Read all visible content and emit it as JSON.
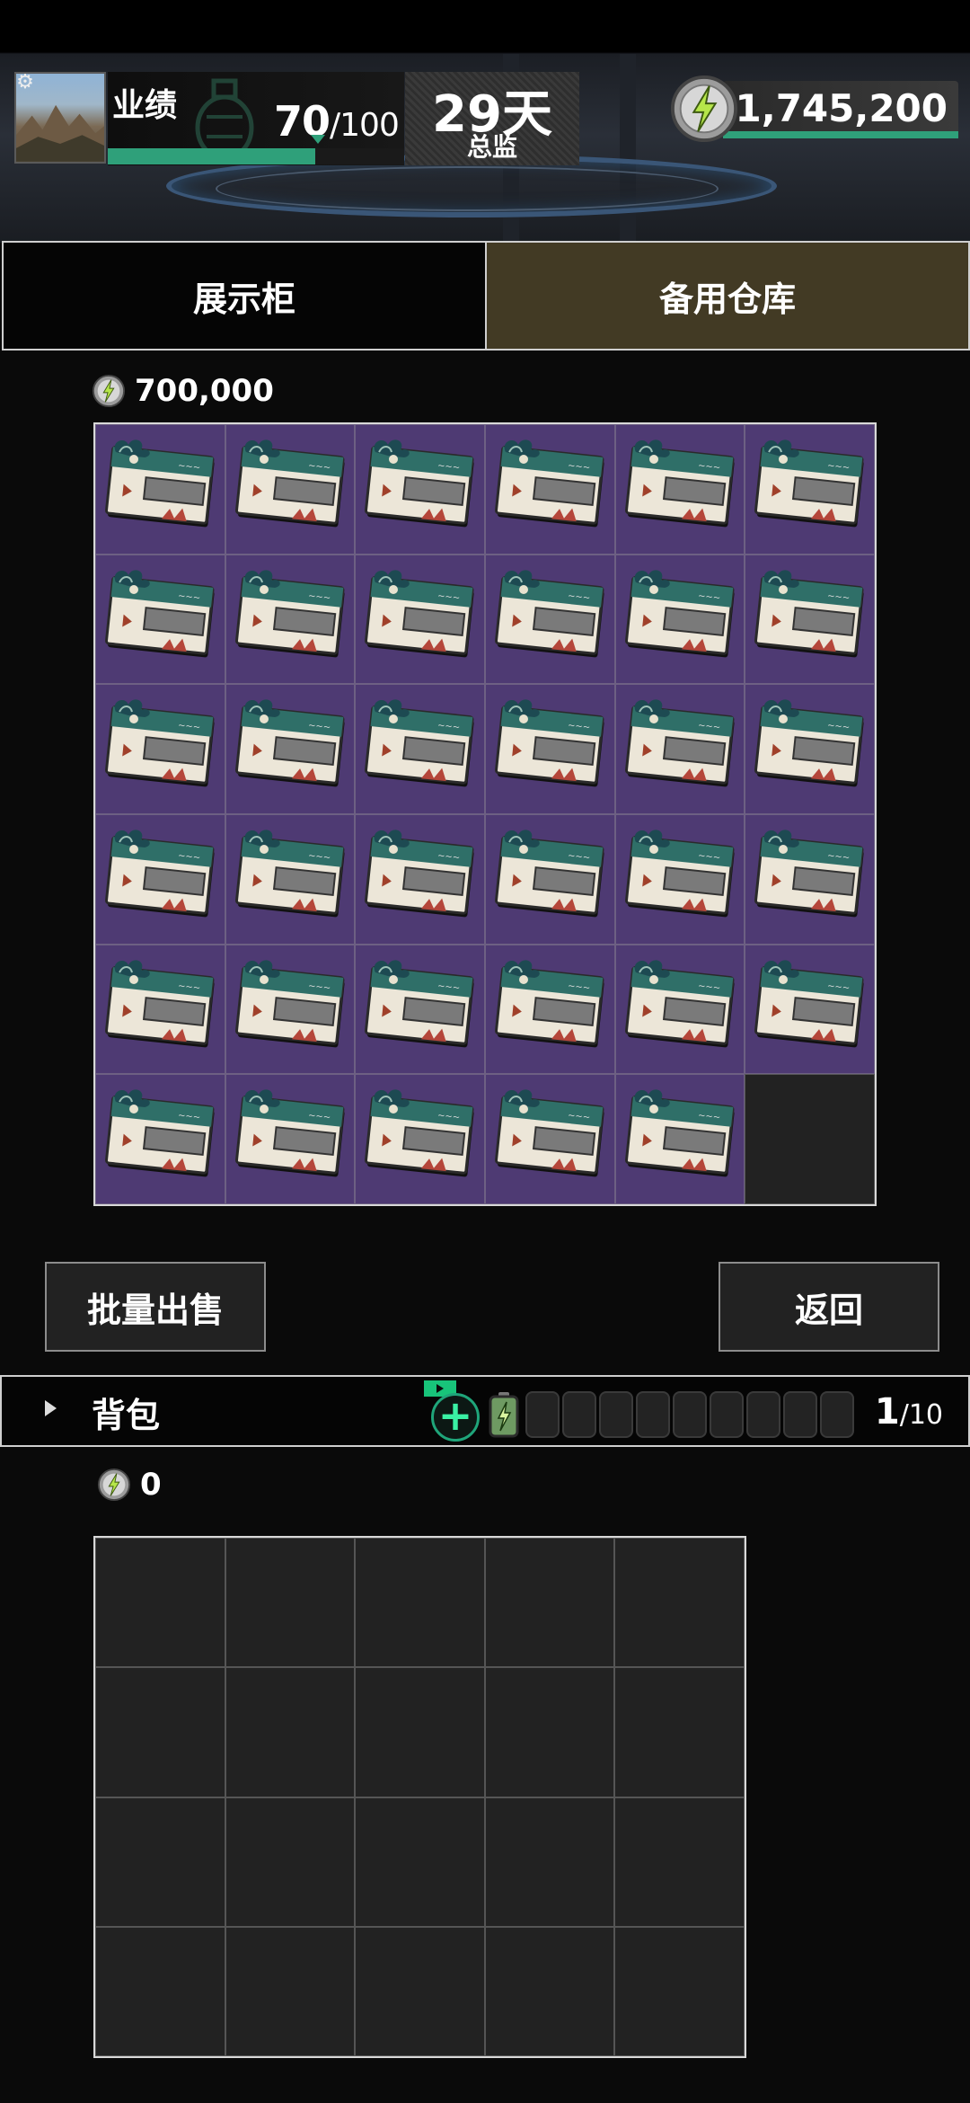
{
  "hud": {
    "performance_label": "业绩",
    "performance_value": "70",
    "performance_max": "/100",
    "performance_progress": 0.7,
    "day_count": "29天",
    "rank_title": "总监",
    "coins": "1,745,200"
  },
  "tabs": [
    {
      "label": "展示柜",
      "active": false
    },
    {
      "label": "备用仓库",
      "active": true
    }
  ],
  "storage": {
    "total_value": "700,000",
    "columns": 6,
    "rows": 6,
    "filled_cells": 35,
    "item_icon": "ticket-icon"
  },
  "buttons": {
    "bulk_sell": "批量出售",
    "back": "返回"
  },
  "backpack": {
    "title": "背包",
    "count": "1",
    "capacity": "/10",
    "total_value": "0",
    "columns": 5,
    "rows": 4
  },
  "colors": {
    "accent_green": "#2fa07a",
    "cell_purple": "#4e3a73",
    "tab_active": "#423a24"
  }
}
